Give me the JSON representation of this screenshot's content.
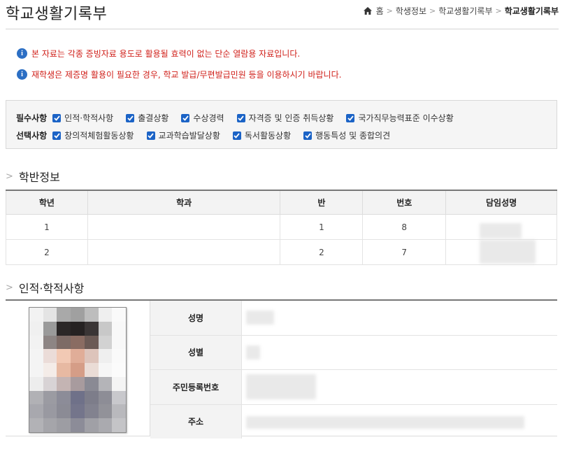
{
  "page": {
    "title": "학교생활기록부"
  },
  "breadcrumb": {
    "home": "홈",
    "level1": "학생정보",
    "level2": "학교생활기록부",
    "current": "학교생활기록부",
    "separator": ">"
  },
  "notices": [
    "본 자료는 각종 증빙자료 용도로 활용될 효력이 없는 단순 열람용 자료입니다.",
    "재학생은 제증명 활용이 필요한 경우, 학교 발급/무편발급민원 등을 이용하시기 바랍니다."
  ],
  "filters": {
    "required_label": "필수사항",
    "required_items": [
      {
        "label": "인적·학적사항",
        "checked": true
      },
      {
        "label": "출결상황",
        "checked": true
      },
      {
        "label": "수상경력",
        "checked": true
      },
      {
        "label": "자격증 및 인증 취득상황",
        "checked": true
      },
      {
        "label": "국가직무능력표준 이수상황",
        "checked": true
      }
    ],
    "optional_label": "선택사항",
    "optional_items": [
      {
        "label": "창의적체험활동상황",
        "checked": true
      },
      {
        "label": "교과학습발달상황",
        "checked": true
      },
      {
        "label": "독서활동상황",
        "checked": true
      },
      {
        "label": "행동특성 및 종합의견",
        "checked": true
      }
    ]
  },
  "class_info": {
    "section_title": "학반정보",
    "headers": [
      "학년",
      "학과",
      "반",
      "번호",
      "담임성명"
    ],
    "rows": [
      {
        "grade": "1",
        "dept": "",
        "class": "1",
        "number": "8",
        "teacher": ""
      },
      {
        "grade": "2",
        "dept": "",
        "class": "2",
        "number": "7",
        "teacher": ""
      }
    ]
  },
  "personal_info": {
    "section_title": "인적·학적사항",
    "labels": {
      "name": "성명",
      "gender": "성별",
      "resident_id": "주민등록번호",
      "address": "주소"
    }
  },
  "colors": {
    "notice_red": "#d0201a",
    "info_blue": "#2c6fc4",
    "checkbox_blue": "#1b63c6"
  }
}
